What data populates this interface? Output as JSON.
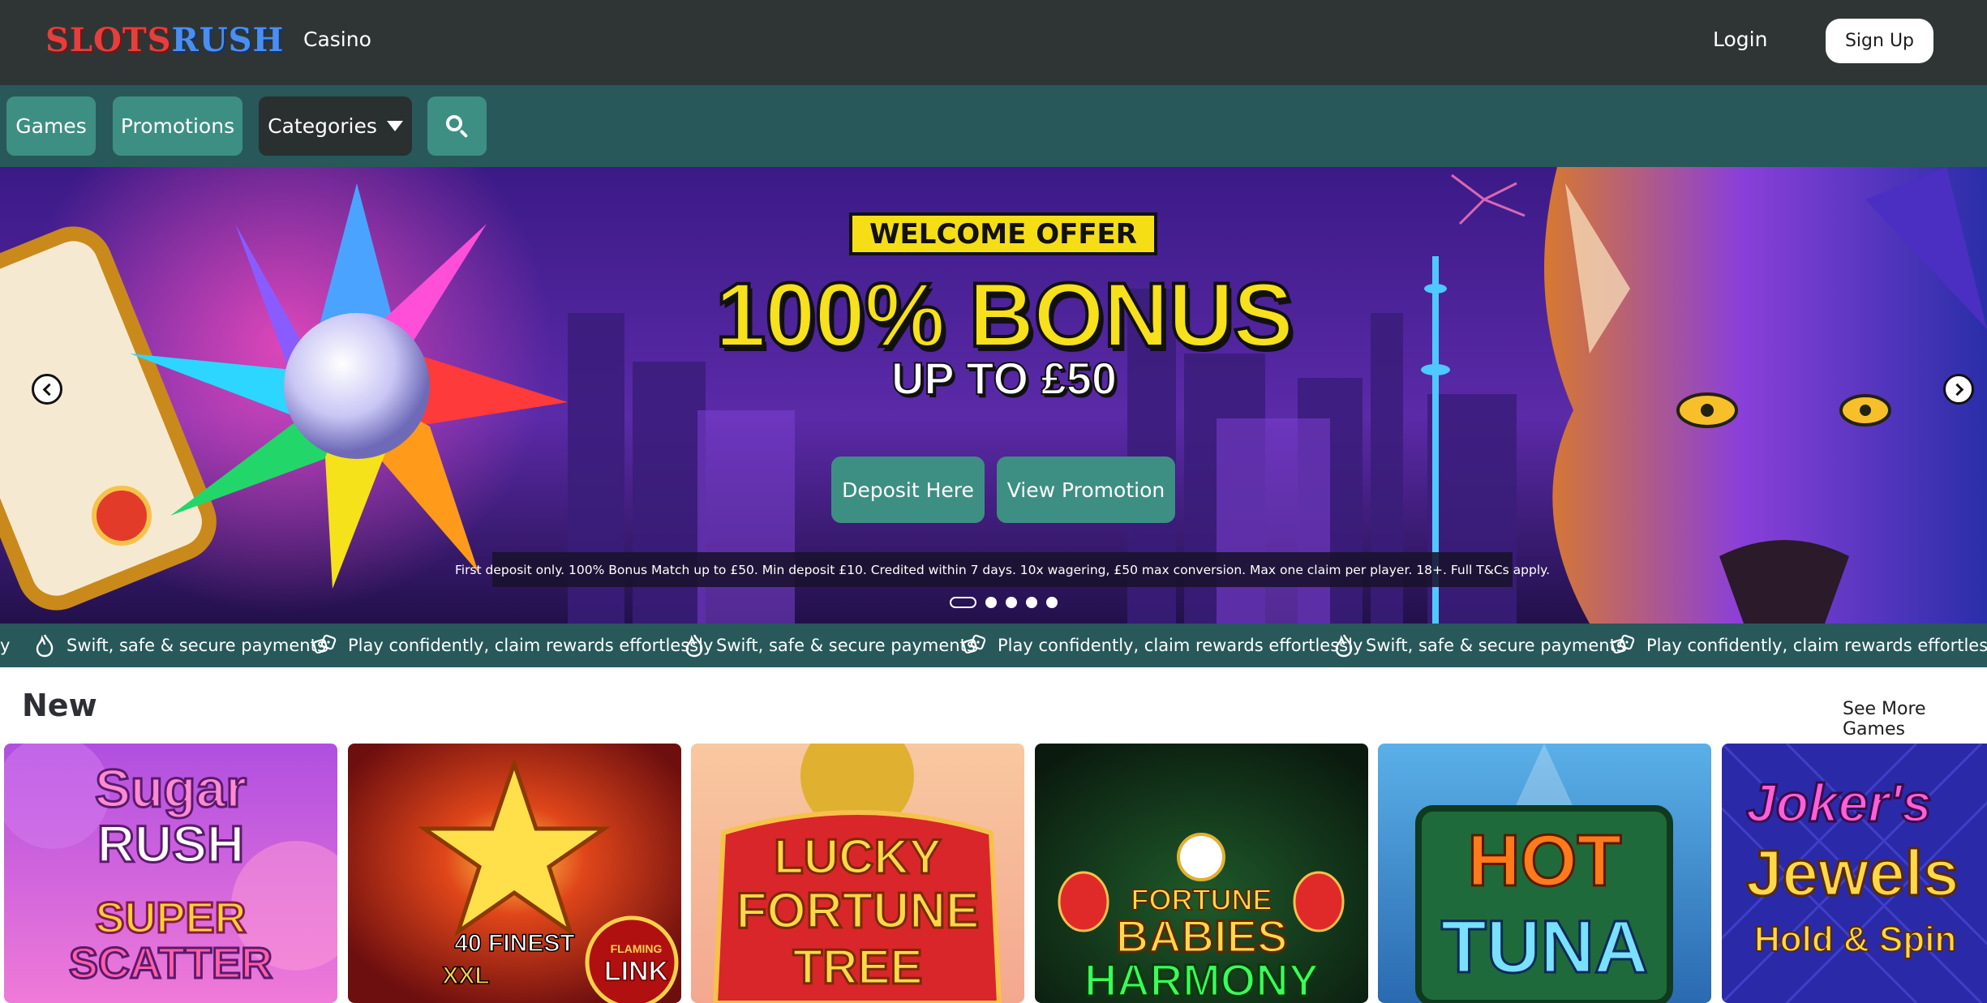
{
  "header": {
    "logo_part1": "SLOTS",
    "logo_part2": "RUSH",
    "nav_casino": "Casino",
    "login": "Login",
    "signup": "Sign Up"
  },
  "subnav": {
    "games": "Games",
    "promotions": "Promotions",
    "categories": "Categories",
    "search_icon": "search-icon"
  },
  "hero": {
    "badge": "WELCOME OFFER",
    "headline": "100% BONUS",
    "subheadline": "UP TO £50",
    "deposit_button": "Deposit Here",
    "promotion_button": "View Promotion",
    "terms": "First deposit only. 100% Bonus Match up to £50. Min deposit £10. Credited within 7 days. 10x wagering, £50 max conversion. Max one claim per player. 18+. Full T&Cs apply.",
    "slide_count": 5,
    "active_slide": 1
  },
  "ticker": {
    "edge_fragment": "y",
    "payments": "Swift, safe & secure payments",
    "rewards": "Play confidently, claim rewards effortlessly"
  },
  "new_section": {
    "title": "New",
    "see_more": "See More Games",
    "games": [
      {
        "title_line1": "Sugar",
        "title_line2": "RUSH",
        "title_line3": "SUPER",
        "title_line4": "SCATTER"
      },
      {
        "title_line1": "40 FINEST",
        "title_line2": "XXL",
        "title_line3": "FLAMING",
        "title_line4": "LINK"
      },
      {
        "title_line1": "LUCKY",
        "title_line2": "FORTUNE",
        "title_line3": "TREE",
        "title_line4": ""
      },
      {
        "title_line1": "FORTUNE",
        "title_line2": "BABIES",
        "title_line3": "HARMONY",
        "title_line4": ""
      },
      {
        "title_line1": "HOT",
        "title_line2": "TUNA",
        "title_line3": "",
        "title_line4": ""
      },
      {
        "title_line1": "Joker's",
        "title_line2": "Jewels",
        "title_line3": "Hold & Spin",
        "title_line4": ""
      }
    ]
  },
  "colors": {
    "header_bg": "#2f3535",
    "nav_bg": "#28585a",
    "accent_teal": "#3e8f83",
    "headline_yellow": "#f7e01c"
  }
}
